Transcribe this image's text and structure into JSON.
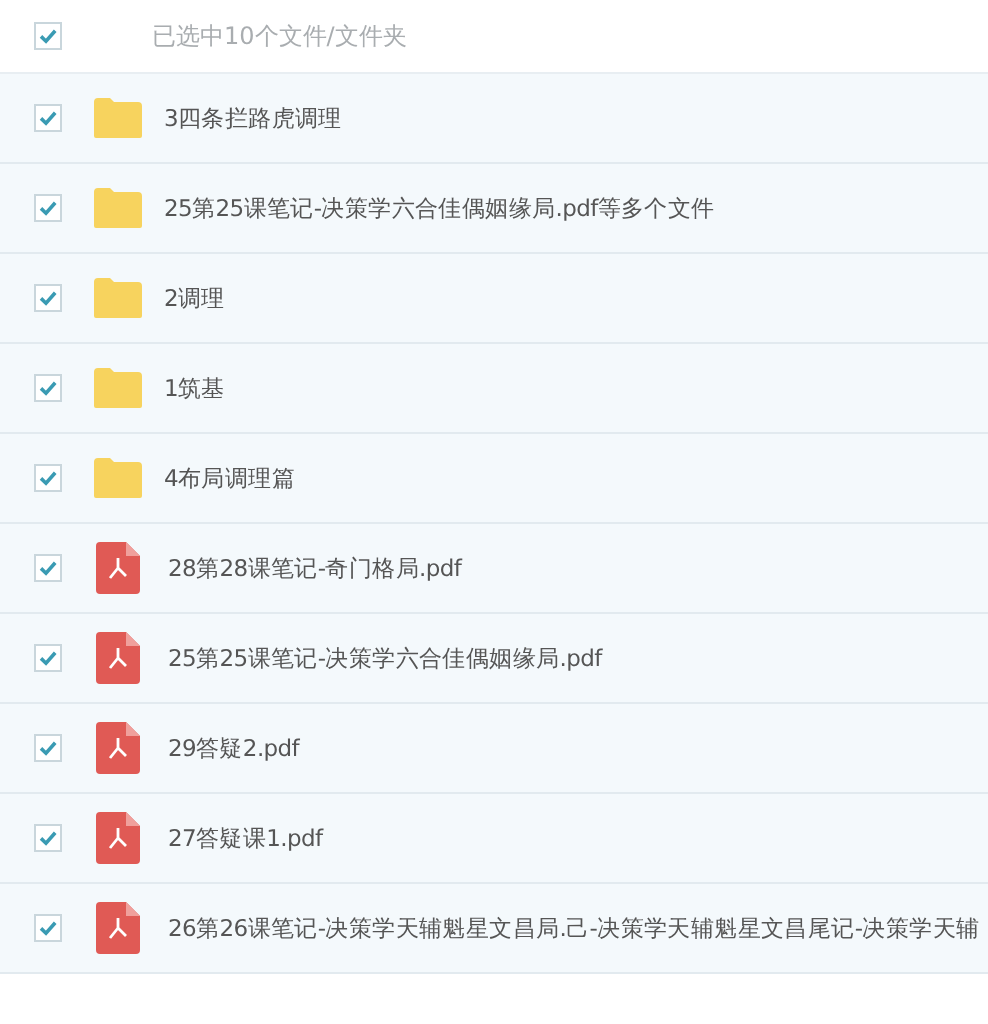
{
  "header": {
    "checked": true,
    "label": "已选中10个文件/文件夹"
  },
  "files": [
    {
      "kind": "folder",
      "name": "3四条拦路虎调理",
      "checked": true
    },
    {
      "kind": "folder",
      "name": "25第25课笔记-决策学六合佳偶姻缘局.pdf等多个文件",
      "checked": true
    },
    {
      "kind": "folder",
      "name": "2调理",
      "checked": true
    },
    {
      "kind": "folder",
      "name": "1筑基",
      "checked": true
    },
    {
      "kind": "folder",
      "name": "4布局调理篇",
      "checked": true
    },
    {
      "kind": "pdf",
      "name": "28第28课笔记-奇门格局.pdf",
      "checked": true
    },
    {
      "kind": "pdf",
      "name": "25第25课笔记-决策学六合佳偶姻缘局.pdf",
      "checked": true
    },
    {
      "kind": "pdf",
      "name": "29答疑2.pdf",
      "checked": true
    },
    {
      "kind": "pdf",
      "name": "27答疑课1.pdf",
      "checked": true
    },
    {
      "kind": "pdf",
      "name": "26第26课笔记-决策学天辅魁星文昌局.己-决策学天辅魁星文昌尾记-决策学天辅",
      "checked": true
    }
  ]
}
